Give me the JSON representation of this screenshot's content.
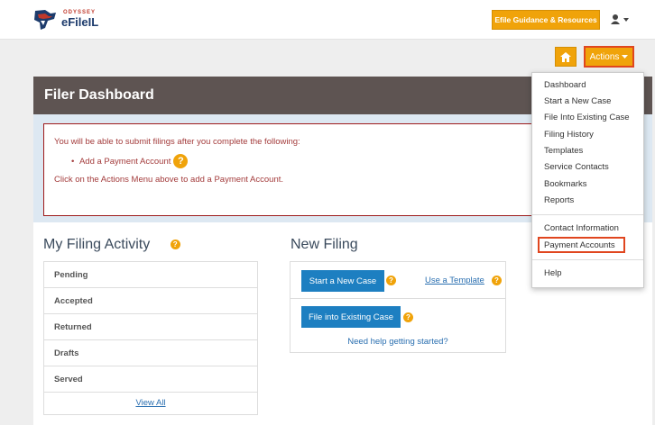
{
  "header": {
    "brand_small": "ODYSSEY",
    "brand_name": "eFileIL",
    "guidance_button": "Efile Guidance & Resources",
    "user_icon": "user-icon"
  },
  "toolbar": {
    "home_icon": "home-icon",
    "actions_label": "Actions"
  },
  "dashboard": {
    "title": "Filer Dashboard",
    "notice": {
      "line1": "You will be able to submit filings after you complete the following:",
      "bullet": "Add a Payment Account",
      "line3": "Click on the Actions Menu above to add a Payment Account."
    }
  },
  "filing_activity": {
    "title": "My Filing Activity",
    "items": [
      "Pending",
      "Accepted",
      "Returned",
      "Drafts",
      "Served"
    ],
    "view_all": "View All"
  },
  "new_filing": {
    "title": "New Filing",
    "start_case": "Start a New Case",
    "use_template": "Use a Template",
    "file_existing": "File into Existing Case",
    "help_link": "Need help getting started?"
  },
  "actions_menu": {
    "group1": [
      "Dashboard",
      "Start a New Case",
      "File Into Existing Case",
      "Filing History",
      "Templates",
      "Service Contacts",
      "Bookmarks",
      "Reports"
    ],
    "group2": [
      "Contact Information",
      "Payment Accounts"
    ],
    "group3": [
      "Help"
    ],
    "highlighted": "Payment Accounts"
  },
  "colors": {
    "accent_orange": "#f0a30a",
    "highlight_red": "#e0461f",
    "header_brown": "#5e5452",
    "button_blue": "#1d7fc1"
  }
}
